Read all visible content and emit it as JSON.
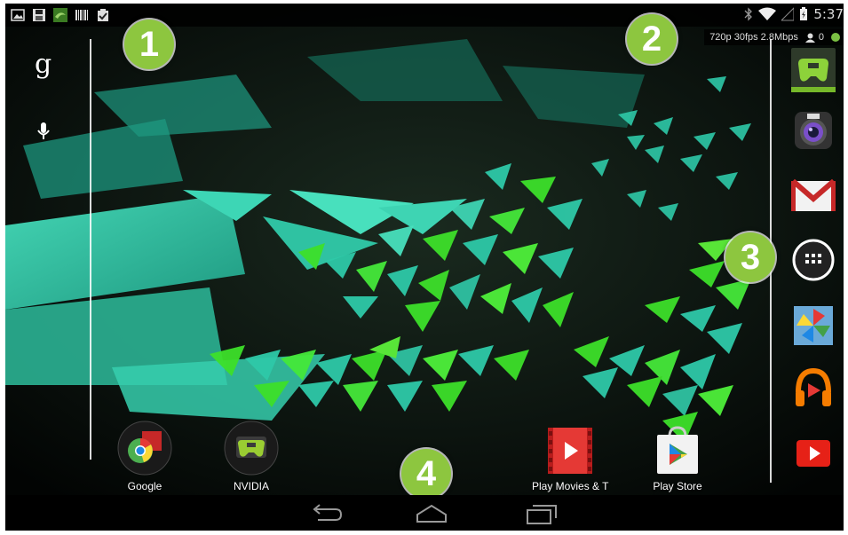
{
  "status_bar": {
    "notification_icons": [
      "gallery-icon",
      "save-icon",
      "nvidia-icon",
      "barcode-icon",
      "clipboard-check-icon"
    ],
    "time": "5:37"
  },
  "stream_info": {
    "text": "720p 30fps 2.8Mbps",
    "user_count": "0"
  },
  "search": {
    "logo": "g"
  },
  "dock": {
    "apps": [
      "NVIDIA Shield Hub",
      "Camera",
      "Gmail",
      "All apps",
      "Photos",
      "Play Music",
      "YouTube"
    ]
  },
  "home": {
    "apps": [
      {
        "label": "Google"
      },
      {
        "label": "NVIDIA"
      },
      {
        "label": "Play Movies & T"
      },
      {
        "label": "Play Store"
      }
    ]
  },
  "callouts": [
    "1",
    "2",
    "3",
    "4"
  ],
  "colors": {
    "accent_green": "#8dc63f",
    "wallpaper_teal": "#2ec9a8",
    "wallpaper_green": "#3cd42a"
  }
}
